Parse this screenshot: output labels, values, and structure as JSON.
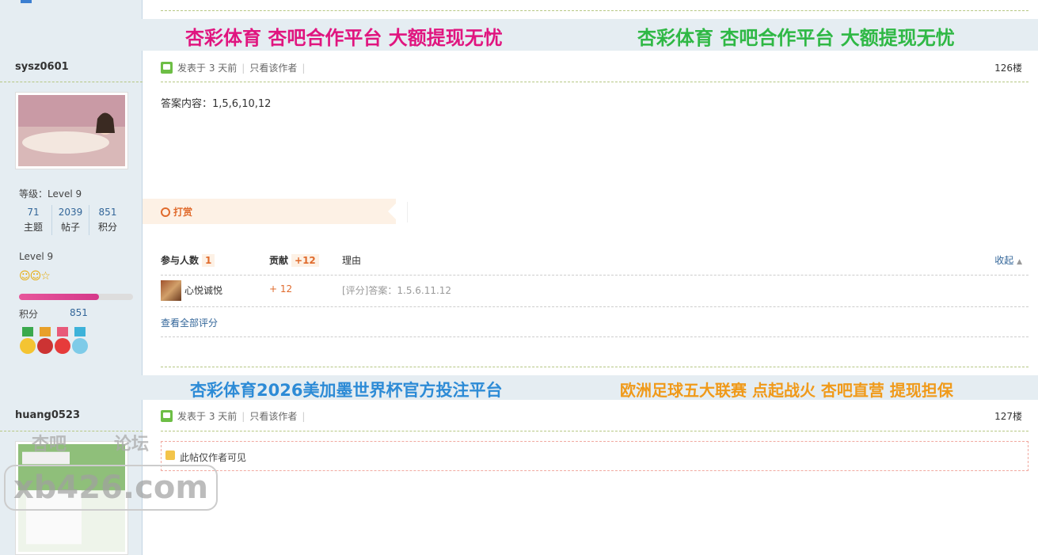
{
  "top_partial_label": "",
  "ads": {
    "row1_left": "杏彩体育 杏吧合作平台 大额提现无忧",
    "row1_left_color": "#e0157f",
    "row1_right": "杏彩体育 杏吧合作平台 大额提现无忧",
    "row1_right_color": "#2fb845",
    "row2_left_prefix": "杏彩体育",
    "row2_left_num": "2026",
    "row2_left_suffix": "美加墨世界杯官方投注平台",
    "row2_left_color": "#2d8bd6",
    "row2_right": "欧洲足球五大联赛 点起战火 杏吧直营 提现担保",
    "row2_right_color": "#f09a1a"
  },
  "post1": {
    "username": "sysz0601",
    "meta_posted": "发表于 3 天前",
    "meta_author_only": "只看该作者",
    "floor": "126楼",
    "content": "答案内容：1,5,6,10,12",
    "level_label": "等级：Level 9",
    "stats": [
      {
        "value": "71",
        "label": "主题"
      },
      {
        "value": "2039",
        "label": "帖子"
      },
      {
        "value": "851",
        "label": "积分"
      }
    ],
    "level_text": "Level 9",
    "points_label": "积分",
    "points_value": "851",
    "progress_fraction": 0.7,
    "tip_label": "打赏",
    "rate": {
      "participants_label": "参与人数",
      "participants_value": "1",
      "contribution_label": "贡献",
      "contribution_value": "+12",
      "reason_label": "理由",
      "collapse_label": "收起",
      "rater_name": "心悦诚悦",
      "rater_value": "+ 12",
      "rater_reason": "[评分]答案：1.5.6.11.12",
      "view_all": "查看全部评分"
    }
  },
  "post2": {
    "username": "huang0523",
    "meta_posted": "发表于 3 天前",
    "meta_author_only": "只看该作者",
    "floor": "127楼",
    "locked_text": "此帖仅作者可见"
  },
  "watermark": {
    "top_text": "杏吧",
    "top_text2": "论坛",
    "main_text": "xb426.com"
  }
}
